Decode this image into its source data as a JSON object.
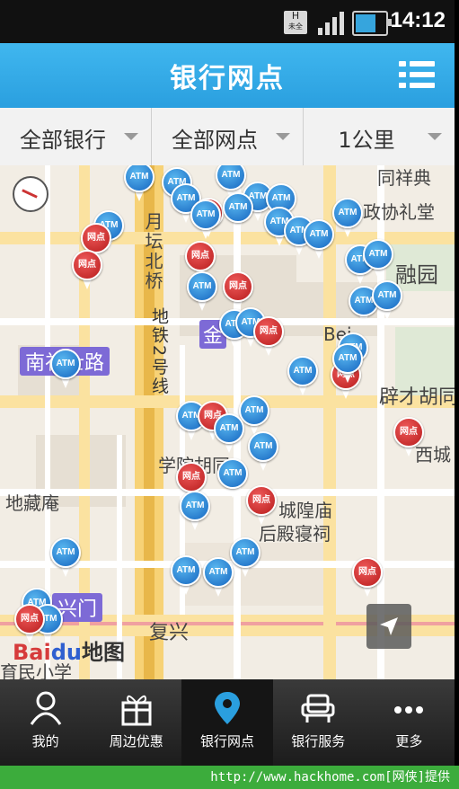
{
  "status_bar": {
    "network_badge": "H",
    "network_sub": "未全",
    "time": "14:12",
    "battery_level": 0.8
  },
  "header": {
    "title": "银行网点",
    "menu_icon": "menu-icon"
  },
  "filters": [
    {
      "label": "全部银行"
    },
    {
      "label": "全部网点"
    },
    {
      "label": "1公里"
    }
  ],
  "map": {
    "labels": {
      "tongxiang": "同祥典",
      "zhengxie": "政协礼堂",
      "rongyuan": "融园",
      "yuetan": "月坛北桥",
      "subway": "地铁2号线",
      "nanlishi": "南礼士路",
      "jin": "金",
      "beijing": "Bei",
      "picai": "辟才胡同",
      "xicheng": "西城",
      "xueyuan": "学院胡同",
      "didian": "地藏庵",
      "chenghuang": "城隍庙",
      "houdian": "后殿寝祠",
      "fuxingmen": "兴门",
      "fuxing2": "复兴",
      "yumin": "育民小学",
      "baidu_text": "Bai",
      "baidu_du": "du",
      "baidu_map": "地图"
    },
    "pin_labels": {
      "atm": "ATM",
      "branch": "网点"
    },
    "pins": [
      {
        "t": "atm"
      },
      {
        "t": "atm"
      },
      {
        "t": "atm"
      },
      {
        "t": "atm"
      },
      {
        "t": "atm"
      },
      {
        "t": "atm"
      },
      {
        "t": "wd"
      },
      {
        "t": "atm"
      },
      {
        "t": "atm"
      },
      {
        "t": "atm"
      },
      {
        "t": "atm"
      },
      {
        "t": "atm"
      },
      {
        "t": "wd"
      },
      {
        "t": "atm"
      },
      {
        "t": "atm"
      },
      {
        "t": "wd"
      },
      {
        "t": "wd"
      },
      {
        "t": "wd"
      },
      {
        "t": "atm"
      },
      {
        "t": "atm"
      },
      {
        "t": "atm"
      },
      {
        "t": "atm"
      },
      {
        "t": "atm"
      },
      {
        "t": "atm"
      },
      {
        "t": "atm"
      },
      {
        "t": "wd"
      },
      {
        "t": "atm"
      },
      {
        "t": "wd"
      },
      {
        "t": "atm"
      },
      {
        "t": "atm"
      },
      {
        "t": "atm"
      },
      {
        "t": "atm"
      },
      {
        "t": "wd"
      },
      {
        "t": "atm"
      },
      {
        "t": "atm"
      },
      {
        "t": "wd"
      },
      {
        "t": "atm"
      },
      {
        "t": "atm"
      },
      {
        "t": "wd"
      },
      {
        "t": "atm"
      },
      {
        "t": "wd"
      },
      {
        "t": "atm"
      },
      {
        "t": "atm"
      },
      {
        "t": "atm"
      },
      {
        "t": "atm"
      },
      {
        "t": "wd"
      },
      {
        "t": "atm"
      },
      {
        "t": "atm"
      },
      {
        "t": "wd"
      }
    ]
  },
  "bottom_nav": [
    {
      "label": "我的",
      "icon": "person-icon",
      "active": false
    },
    {
      "label": "周边优惠",
      "icon": "gift-icon",
      "active": false
    },
    {
      "label": "银行网点",
      "icon": "location-pin-icon",
      "active": true
    },
    {
      "label": "银行服务",
      "icon": "armchair-icon",
      "active": false
    },
    {
      "label": "更多",
      "icon": "more-dots-icon",
      "active": false
    }
  ],
  "footer": {
    "text": "http://www.hackhome.com[网侠]提供"
  },
  "colors": {
    "accent": "#2a9fdf",
    "atm": "#1e88e5",
    "branch": "#d32f2f",
    "footer": "#3cac3c"
  }
}
